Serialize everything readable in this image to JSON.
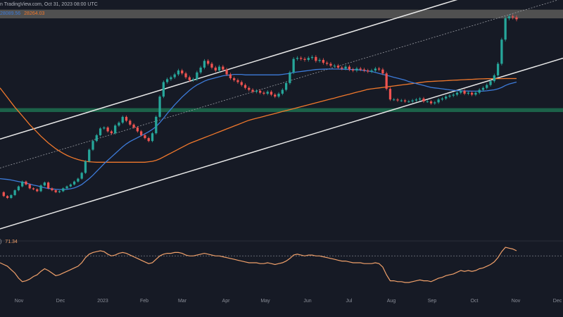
{
  "header": {
    "source_line": "n TradingView.com, Oct 31, 2023 08:00 UTC",
    "ma1_value": "28089.56",
    "ma2_value": "28264.03"
  },
  "rsi_header": {
    "prefix": ")",
    "value": "71.34"
  },
  "colors": {
    "background": "#161a25",
    "bull": "#26a69a",
    "bear": "#ef5350",
    "ma_blue": "#3d7bd9",
    "ma_orange": "#f0782c",
    "rsi_line": "#f0a06a",
    "resistance_zone": "#5b5a58",
    "support_zone": "#1d6a4e",
    "channel": "#e8e8e8",
    "axis_text": "#8a8e98"
  },
  "chart_data": [
    {
      "type": "candlestick",
      "x_axis_labels": [
        "Nov",
        "Dec",
        "2023",
        "Feb",
        "Mar",
        "Apr",
        "May",
        "Jun",
        "Jul",
        "Aug",
        "Sep",
        "Oct",
        "Nov",
        "Dec"
      ],
      "price_series": [
        16500,
        16100,
        15900,
        16200,
        16700,
        17100,
        17600,
        17300,
        16900,
        16800,
        16600,
        17200,
        17500,
        16900,
        16700,
        16500,
        16600,
        16900,
        17100,
        17300,
        17600,
        17900,
        18500,
        19700,
        20900,
        21800,
        22400,
        23100,
        23200,
        22800,
        22600,
        23400,
        23700,
        24300,
        23900,
        23500,
        23200,
        22800,
        22400,
        22100,
        21800,
        22600,
        24300,
        26400,
        27900,
        28200,
        28400,
        28700,
        29100,
        28800,
        28400,
        28100,
        28200,
        28900,
        29400,
        30100,
        29800,
        29400,
        29100,
        29500,
        29200,
        28700,
        28300,
        28100,
        27900,
        27600,
        27300,
        27100,
        26900,
        27000,
        26800,
        26700,
        26900,
        26600,
        26400,
        26700,
        27100,
        27800,
        28900,
        30300,
        30400,
        30300,
        30200,
        30400,
        30500,
        30100,
        30200,
        29900,
        29800,
        29600,
        29600,
        29400,
        29300,
        29500,
        29200,
        29100,
        29300,
        29200,
        29100,
        29000,
        29100,
        29300,
        29200,
        28800,
        27200,
        26100,
        26100,
        26000,
        26000,
        25900,
        25900,
        26000,
        26100,
        26200,
        25900,
        25900,
        25700,
        25800,
        26100,
        26200,
        26400,
        26500,
        26600,
        26800,
        27000,
        26700,
        26800,
        26600,
        26800,
        27100,
        27300,
        27600,
        28000,
        28600,
        29800,
        32300,
        34500,
        34700,
        34600,
        34400
      ],
      "ma_blue": [
        17900,
        17860,
        17820,
        17760,
        17680,
        17600,
        17520,
        17440,
        17340,
        17240,
        17160,
        17060,
        16960,
        16890,
        16840,
        16800,
        16780,
        16780,
        16800,
        16850,
        16950,
        17100,
        17300,
        17600,
        17900,
        18250,
        18650,
        19050,
        19450,
        19800,
        20150,
        20500,
        20850,
        21200,
        21500,
        21750,
        21950,
        22150,
        22350,
        22550,
        22750,
        23000,
        23300,
        23700,
        24150,
        24650,
        25100,
        25550,
        25950,
        26350,
        26700,
        27050,
        27350,
        27600,
        27800,
        28000,
        28150,
        28250,
        28350,
        28450,
        28550,
        28600,
        28650,
        28700,
        28700,
        28700,
        28650,
        28650,
        28650,
        28650,
        28650,
        28650,
        28650,
        28650,
        28650,
        28650,
        28700,
        28750,
        28800,
        28900,
        28950,
        29000,
        29050,
        29100,
        29150,
        29200,
        29220,
        29240,
        29250,
        29250,
        29250,
        29250,
        29240,
        29230,
        29210,
        29200,
        29180,
        29150,
        29100,
        29050,
        29000,
        28900,
        28800,
        28700,
        28600,
        28500,
        28400,
        28300,
        28200,
        28100,
        27950,
        27850,
        27750,
        27650,
        27550,
        27450,
        27350,
        27300,
        27250,
        27200,
        27150,
        27100,
        27050,
        27020,
        27000,
        26980,
        26970,
        26960,
        26960,
        26960,
        26970,
        27000,
        27050,
        27100,
        27200,
        27350,
        27550,
        27700,
        27800,
        27900
      ],
      "ma_orange": [
        27300,
        26800,
        26300,
        25800,
        25300,
        24850,
        24400,
        23950,
        23500,
        23100,
        22700,
        22300,
        21950,
        21600,
        21300,
        21000,
        20750,
        20520,
        20320,
        20150,
        20000,
        19880,
        19780,
        19700,
        19650,
        19620,
        19600,
        19600,
        19600,
        19600,
        19600,
        19600,
        19600,
        19600,
        19600,
        19600,
        19600,
        19600,
        19600,
        19600,
        19650,
        19700,
        19800,
        19950,
        20150,
        20350,
        20550,
        20750,
        20950,
        21150,
        21350,
        21550,
        21700,
        21850,
        22000,
        22150,
        22300,
        22450,
        22600,
        22750,
        22900,
        23050,
        23200,
        23350,
        23500,
        23650,
        23800,
        23950,
        24050,
        24150,
        24250,
        24350,
        24450,
        24550,
        24650,
        24750,
        24850,
        24950,
        25050,
        25150,
        25250,
        25350,
        25450,
        25550,
        25650,
        25750,
        25850,
        25950,
        26050,
        26150,
        26250,
        26350,
        26450,
        26550,
        26650,
        26750,
        26850,
        26950,
        27050,
        27150,
        27200,
        27250,
        27300,
        27350,
        27400,
        27450,
        27500,
        27550,
        27600,
        27650,
        27700,
        27750,
        27800,
        27850,
        27900,
        27950,
        27970,
        27990,
        28010,
        28030,
        28050,
        28070,
        28090,
        28110,
        28130,
        28150,
        28170,
        28190,
        28210,
        28230,
        28240,
        28250,
        28255,
        28260,
        28262,
        28263,
        28264,
        28264,
        28264,
        28264
      ],
      "resistance_zone": [
        34500,
        35400
      ],
      "support_zone": [
        24800,
        25200
      ],
      "channel_upper": [
        {
          "x": 0,
          "y": 22000
        },
        {
          "x": 138,
          "y": 38200
        }
      ],
      "channel_lower": [
        {
          "x": 0,
          "y": 12700
        },
        {
          "x": 138,
          "y": 28800
        }
      ],
      "trend_dotted": [
        {
          "x": 0,
          "y": 19000
        },
        {
          "x": 138,
          "y": 35000
        }
      ],
      "ylim": [
        11600,
        36400
      ],
      "grid": false
    },
    {
      "type": "line",
      "name": "RSI",
      "values": [
        62,
        60,
        58,
        54,
        50,
        44,
        40,
        41,
        43,
        46,
        48,
        52,
        55,
        53,
        50,
        47,
        48,
        50,
        52,
        54,
        56,
        58,
        62,
        68,
        72,
        74,
        75,
        76,
        75,
        72,
        70,
        71,
        73,
        74,
        73,
        71,
        69,
        67,
        65,
        63,
        61,
        62,
        66,
        70,
        72,
        73,
        73,
        74,
        74,
        73,
        71,
        70,
        70,
        71,
        72,
        73,
        72,
        71,
        70,
        70,
        69,
        68,
        67,
        66,
        65,
        64,
        63,
        62,
        62,
        62,
        61,
        61,
        62,
        61,
        60,
        61,
        62,
        64,
        67,
        71,
        72,
        71,
        70,
        71,
        71,
        70,
        70,
        69,
        68,
        67,
        66,
        65,
        64,
        64,
        63,
        62,
        62,
        62,
        61,
        61,
        61,
        62,
        61,
        57,
        48,
        41,
        41,
        40,
        40,
        39,
        39,
        40,
        41,
        42,
        41,
        41,
        40,
        42,
        44,
        45,
        47,
        48,
        49,
        51,
        53,
        52,
        53,
        52,
        53,
        55,
        56,
        58,
        60,
        63,
        68,
        75,
        80,
        79,
        78,
        76
      ],
      "overbought_level": 70,
      "ylim": [
        30,
        85
      ]
    }
  ]
}
